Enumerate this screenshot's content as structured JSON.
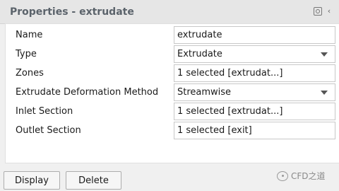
{
  "header": {
    "title": "Properties - extrudate",
    "icons": [
      "pin-icon",
      "chevron-left-icon"
    ]
  },
  "properties": {
    "name": {
      "label": "Name",
      "value": "extrudate"
    },
    "type": {
      "label": "Type",
      "value": "Extrudate"
    },
    "zones": {
      "label": "Zones",
      "value": "1 selected [extrudat...]"
    },
    "method": {
      "label": "Extrudate Deformation Method",
      "value": "Streamwise"
    },
    "inlet": {
      "label": "Inlet Section",
      "value": "1 selected [extrudat...]"
    },
    "outlet": {
      "label": "Outlet Section",
      "value": "1 selected [exit]"
    }
  },
  "buttons": {
    "display": "Display",
    "delete": "Delete"
  },
  "watermark": {
    "text": "CFD之道"
  }
}
